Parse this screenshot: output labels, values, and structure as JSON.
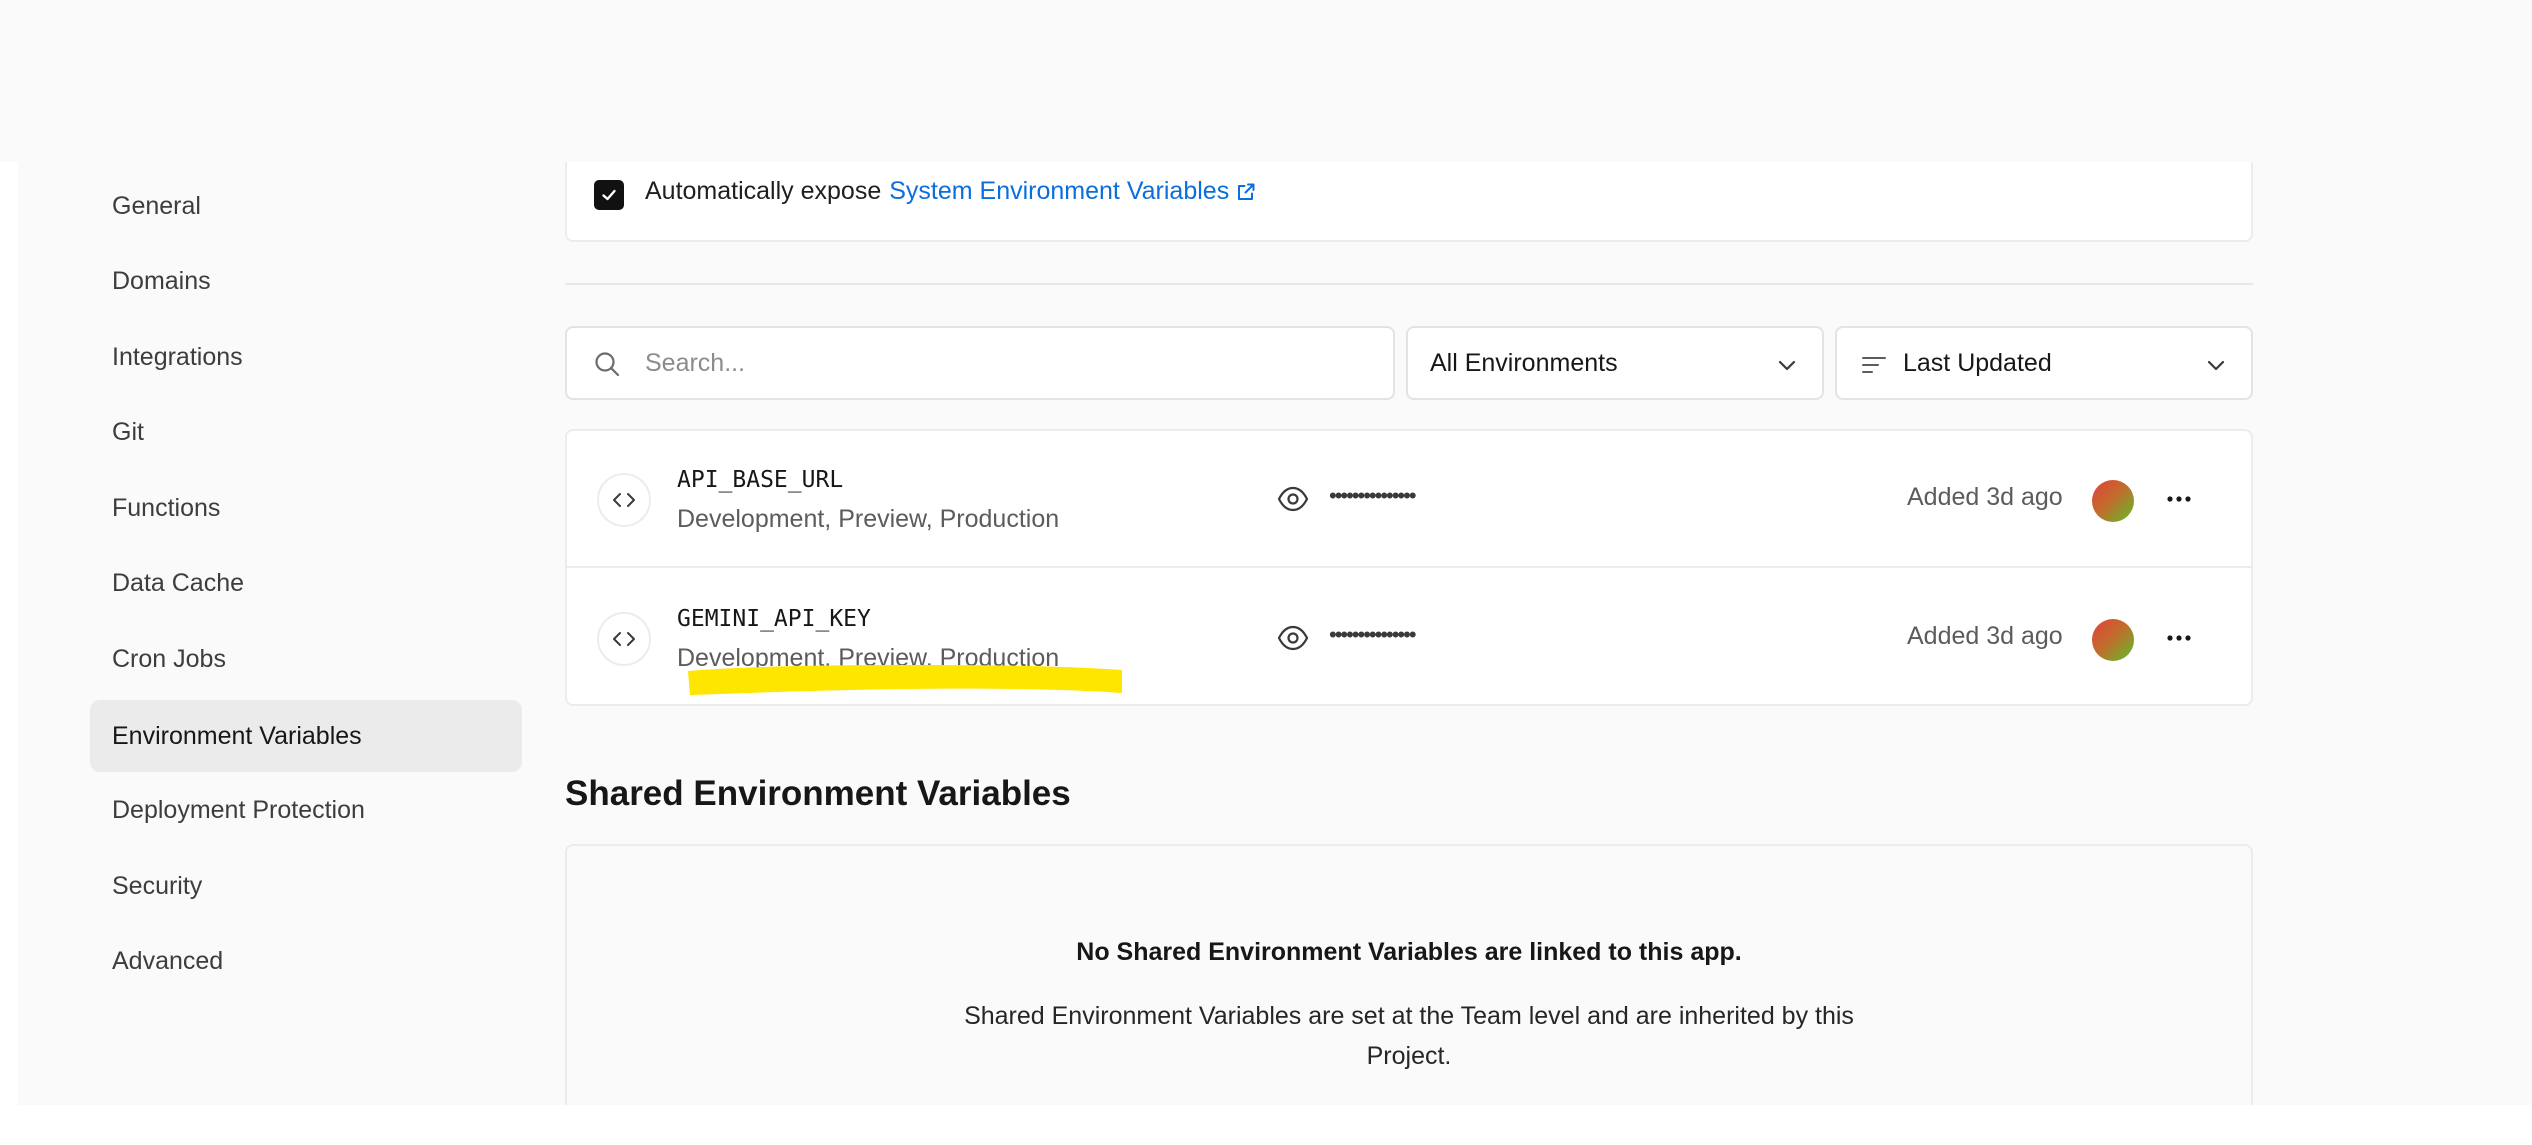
{
  "sidebar": {
    "items": [
      {
        "label": "General"
      },
      {
        "label": "Domains"
      },
      {
        "label": "Integrations"
      },
      {
        "label": "Git"
      },
      {
        "label": "Functions"
      },
      {
        "label": "Data Cache"
      },
      {
        "label": "Cron Jobs"
      },
      {
        "label": "Environment Variables",
        "active": true
      },
      {
        "label": "Deployment Protection"
      },
      {
        "label": "Security"
      },
      {
        "label": "Advanced"
      }
    ]
  },
  "expose": {
    "checked": true,
    "text": "Automatically expose",
    "link": "System Environment Variables"
  },
  "filters": {
    "search_placeholder": "Search...",
    "environment": "All Environments",
    "sort": "Last Updated"
  },
  "variables": [
    {
      "name": "API_BASE_URL",
      "envs": "Development, Preview, Production",
      "value": "•••••••••••••••",
      "added": "Added 3d ago"
    },
    {
      "name": "GEMINI_API_KEY",
      "envs": "Development, Preview, Production",
      "value": "•••••••••••••••",
      "added": "Added 3d ago"
    }
  ],
  "shared": {
    "title": "Shared Environment Variables",
    "empty_title": "No Shared Environment Variables are linked to this app.",
    "empty_desc": "Shared Environment Variables are set at the Team level and are inherited by this Project."
  },
  "colors": {
    "link": "#0a6fdc",
    "highlight": "#ffe600",
    "active_bg": "#ebebeb"
  }
}
